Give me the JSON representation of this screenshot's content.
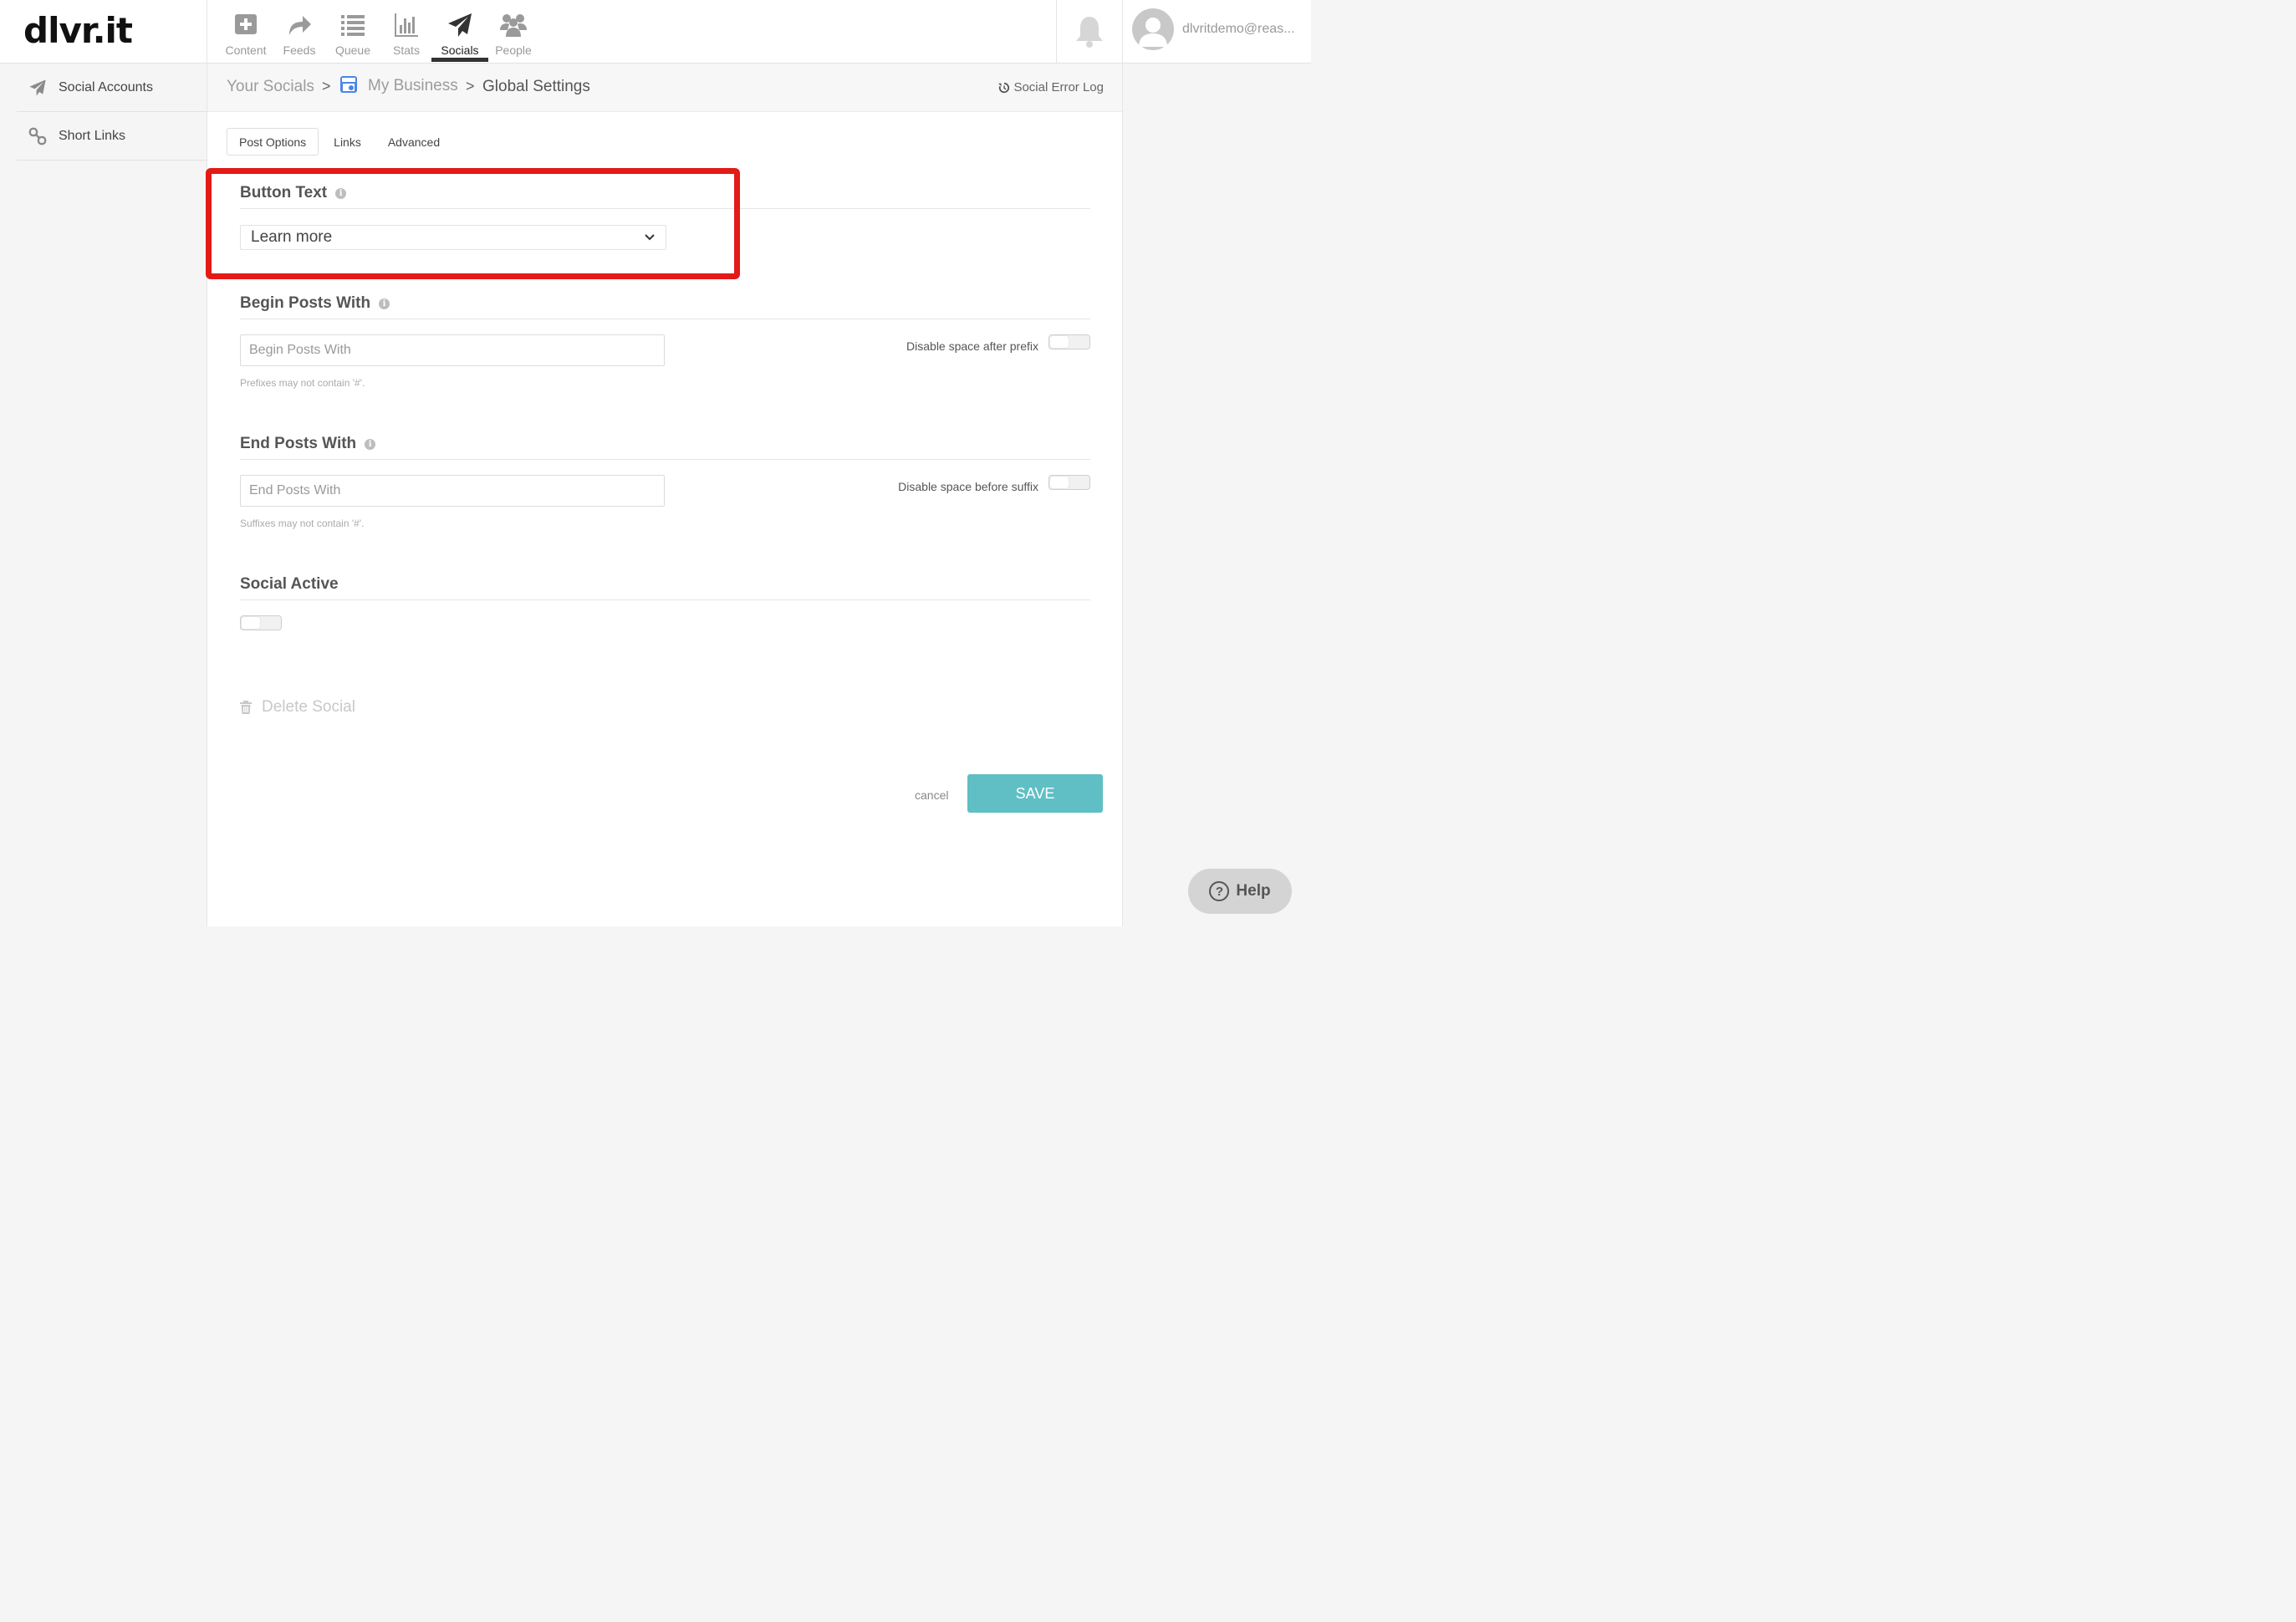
{
  "brand": {
    "logo": "dlvr.it"
  },
  "nav": {
    "items": [
      {
        "label": "Content",
        "icon": "add-content-icon",
        "active": false
      },
      {
        "label": "Feeds",
        "icon": "share-arrow-icon",
        "active": false
      },
      {
        "label": "Queue",
        "icon": "list-icon",
        "active": false
      },
      {
        "label": "Stats",
        "icon": "bar-chart-icon",
        "active": false
      },
      {
        "label": "Socials",
        "icon": "paper-plane-icon",
        "active": true
      },
      {
        "label": "People",
        "icon": "people-icon",
        "active": false
      }
    ]
  },
  "user": {
    "email": "dlvritdemo@reas..."
  },
  "sidebar": {
    "items": [
      {
        "label": "Social Accounts",
        "icon": "paper-plane-icon"
      },
      {
        "label": "Short Links",
        "icon": "link-icon"
      }
    ]
  },
  "breadcrumb": {
    "items": [
      "Your Socials",
      "My Business",
      "Global Settings"
    ],
    "separator": ">"
  },
  "error_log": {
    "label": "Social Error Log"
  },
  "tabs": [
    {
      "label": "Post Options",
      "active": true
    },
    {
      "label": "Links",
      "active": false
    },
    {
      "label": "Advanced",
      "active": false
    }
  ],
  "button_text": {
    "title": "Button Text",
    "value": "Learn more"
  },
  "begin_posts": {
    "title": "Begin Posts With",
    "placeholder": "Begin Posts With",
    "hint": "Prefixes may not contain '#'.",
    "toggle_label": "Disable space after prefix",
    "toggle_on": false
  },
  "end_posts": {
    "title": "End Posts With",
    "placeholder": "End Posts With",
    "hint": "Suffixes may not contain '#'.",
    "toggle_label": "Disable space before suffix",
    "toggle_on": false
  },
  "social_active": {
    "title": "Social Active",
    "toggle_on": false
  },
  "actions": {
    "delete_label": "Delete Social",
    "cancel_label": "cancel",
    "save_label": "SAVE"
  },
  "help": {
    "label": "Help"
  },
  "colors": {
    "accent": "#5fbfc4",
    "highlight": "#e31a17"
  }
}
